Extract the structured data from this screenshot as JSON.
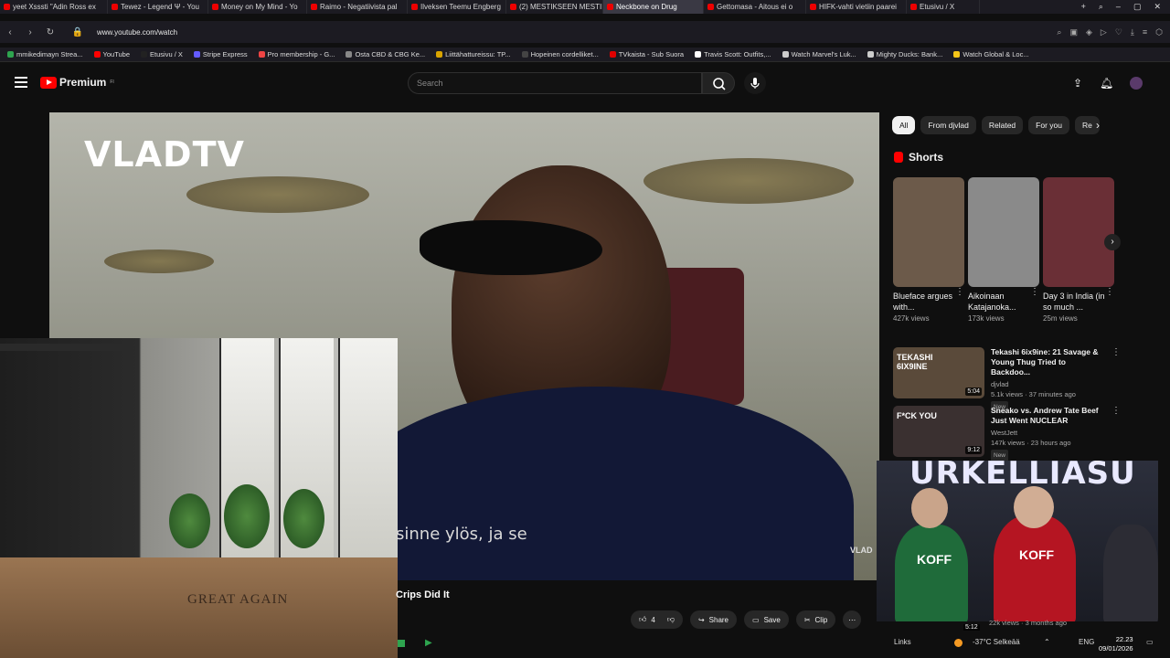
{
  "browser": {
    "tabs": [
      {
        "label": "yeet Xsssti \"Adin Ross ex",
        "active": false
      },
      {
        "label": "Tewez - Legend Ψ - You",
        "active": false
      },
      {
        "label": "Money on My Mind - Yo",
        "active": false
      },
      {
        "label": "Raimo - Negatiivista pal",
        "active": false
      },
      {
        "label": "Ilveksen Teemu Engberg",
        "active": false
      },
      {
        "label": "(2) MESTIKSEEN MESTIK",
        "active": false
      },
      {
        "label": "Neckbone on Drug",
        "active": true
      },
      {
        "label": "Gettomasa - Aitous ei o",
        "active": false
      },
      {
        "label": "HIFK-vahti vietiin paarei",
        "active": false
      },
      {
        "label": "Etusivu / X",
        "active": false
      }
    ],
    "url": "www.youtube.com/watch",
    "bookmarks": [
      {
        "label": "mmikedimayn Strea...",
        "color": "#2ea44f"
      },
      {
        "label": "YouTube",
        "color": "#ff0000"
      },
      {
        "label": "Etusivu / X",
        "color": "#222222"
      },
      {
        "label": "Stripe Express",
        "color": "#635bff"
      },
      {
        "label": "Pro membership - G...",
        "color": "#e44"
      },
      {
        "label": "Osta CBD & CBG Ke...",
        "color": "#888888"
      },
      {
        "label": "Liittähattureissu: TP...",
        "color": "#d9a400"
      },
      {
        "label": "Hopeinen cordelliket...",
        "color": "#444444"
      },
      {
        "label": "TVkaista - Sub Suora",
        "color": "#e00000"
      },
      {
        "label": "Travis Scott: Outfits,...",
        "color": "#ffffff"
      },
      {
        "label": "Watch Marvel's Luk...",
        "color": "#cccccc"
      },
      {
        "label": "Mighty Ducks: Bank...",
        "color": "#cccccc"
      },
      {
        "label": "Watch Global & Loc...",
        "color": "#f5c518"
      }
    ]
  },
  "youtube": {
    "logo_text": "Premium",
    "logo_sup": "FI",
    "search_placeholder": "Search"
  },
  "video": {
    "watermark": "VLADTV",
    "subtitle": "sinne ylös, ja se",
    "corner_mark": "VLAD",
    "title_fragment": "Crips Did It",
    "overlay_text": "GREAT AGAIN",
    "actions": {
      "like_count": "4",
      "share_label": "Share",
      "save_label": "Save",
      "clip_label": "Clip"
    }
  },
  "sidebar": {
    "chips": [
      {
        "label": "All",
        "active": true
      },
      {
        "label": "From djvlad",
        "active": false
      },
      {
        "label": "Related",
        "active": false
      },
      {
        "label": "For you",
        "active": false
      },
      {
        "label": "Re",
        "active": false
      }
    ],
    "shorts_heading": "Shorts",
    "shorts": [
      {
        "title": "Blueface argues with...",
        "views": "427k views",
        "color": "#6c5a4a"
      },
      {
        "title": "Aikoinaan Katajanoka...",
        "views": "173k views",
        "color": "#8a8a8a"
      },
      {
        "title": "Day 3 in India (in so much ...",
        "views": "25m views",
        "color": "#6a2f36"
      }
    ],
    "recommendations": [
      {
        "title": "Tekashi 6ix9ine: 21 Savage & Young Thug Tried to Backdoo...",
        "channel": "djvlad",
        "views": "5.1k views · 37 minutes ago",
        "badge": "New",
        "duration": "5:04",
        "thumb_text": "TEKASHI 6IX9INE",
        "color": "#5a4a3a"
      },
      {
        "title": "Sneako vs. Andrew Tate Beef Just Went NUCLEAR",
        "channel": "WestJett",
        "views": "147k views · 23 hours ago",
        "badge": "New",
        "duration": "9:12",
        "thumb_text": "F*CK YOU",
        "color": "#3a3030"
      }
    ],
    "pip": {
      "banner_text": "URKELLIASU",
      "jersey_text": "KOFF",
      "duration": "5:12",
      "views": "22k views · 3 months ago"
    }
  },
  "taskbar": {
    "links_label": "Links",
    "weather": "-37°C Selkeää",
    "lang": "ENG",
    "time": "22.23",
    "date": "09/01/2026"
  }
}
